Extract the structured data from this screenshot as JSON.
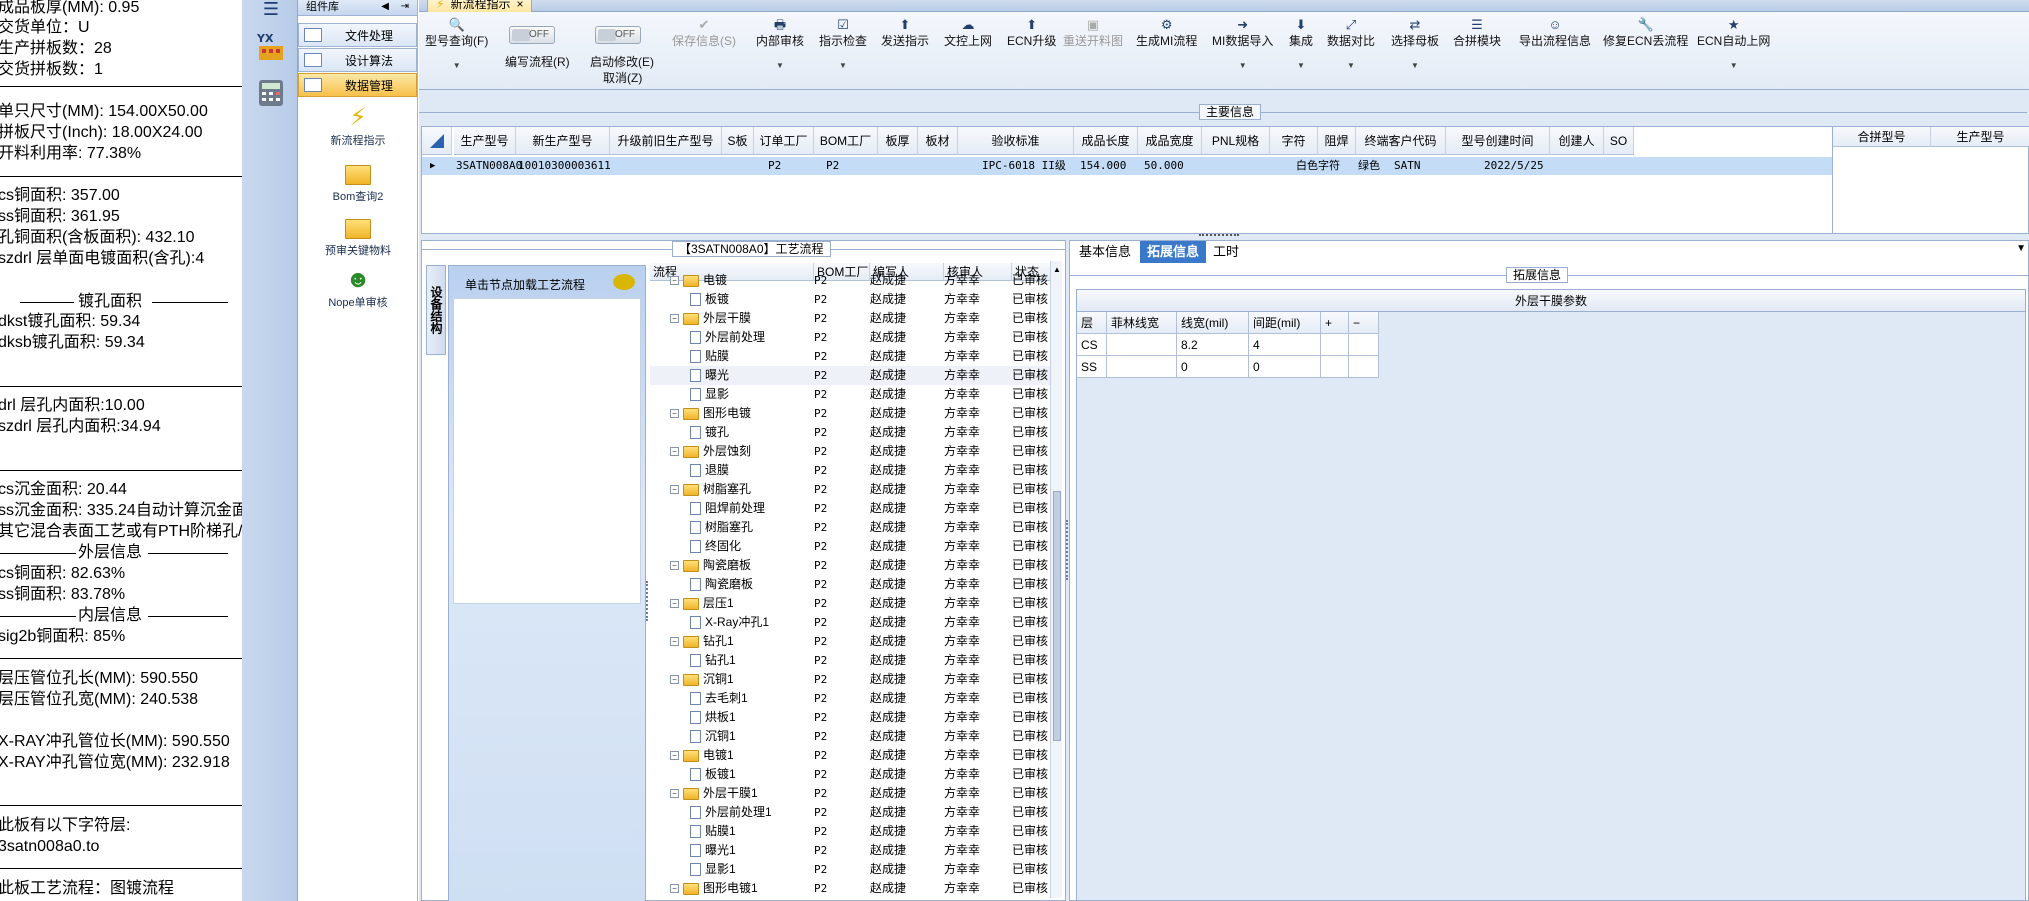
{
  "left_panel": {
    "lines": [
      "成品板厚(MM): 0.95",
      "交货单位：U",
      "生产拼板数：28",
      "交货拼板数：1",
      "单只尺寸(MM): 154.00X50.00",
      "拼板尺寸(Inch): 18.00X24.00",
      "开料利用率: 77.38%",
      "cs铜面积: 357.00",
      "ss铜面积: 361.95",
      "孔铜面积(含板面积): 432.10",
      "szdrl        层单面电镀面积(含孔):4",
      "dkst镀孔面积: 59.34",
      "dksb镀孔面积: 59.34",
      "drl          层孔内面积:10.00",
      "szdrl        层孔内面积:34.94",
      "cs沉金面积: 20.44",
      "ss沉金面积: 335.24自动计算沉金面",
      "其它混合表面工艺或有PTH阶梯孔/",
      "cs铜面积: 82.63%",
      "ss铜面积: 83.78%",
      "sig2b铜面积: 85%",
      "层压管位孔长(MM): 590.550",
      "层压管位孔宽(MM): 240.538",
      "X-RAY冲孔管位长(MM): 590.550",
      "X-RAY冲孔管位宽(MM): 232.918",
      "此板有以下字符层:",
      "3satn008a0.to",
      "此板工艺流程：图镀流程"
    ],
    "section_plating": "镀孔面积",
    "section_outer": "外层信息",
    "section_inner": "内层信息"
  },
  "comp_panel": {
    "title": "组件库",
    "buttons": [
      "文件处理",
      "设计算法",
      "数据管理"
    ],
    "items": [
      "新流程指示",
      "Bom查询2",
      "预审关键物料",
      "Nope单审核"
    ]
  },
  "tab": {
    "title": "新流程指示",
    "close": "×"
  },
  "toolbar": {
    "buttons": [
      {
        "label": "型号查询(F)",
        "icon": "🔍"
      },
      {
        "label": "保存信息(S)",
        "icon": "✔",
        "disabled": true
      },
      {
        "label": "内部审核",
        "icon": "🖶"
      },
      {
        "label": "指示检查",
        "icon": "☑"
      },
      {
        "label": "发送指示",
        "icon": "⬆"
      },
      {
        "label": "文控上网",
        "icon": "☁"
      },
      {
        "label": "ECN升级",
        "icon": "⬆"
      },
      {
        "label": "重送开料图",
        "icon": "▣",
        "disabled": true
      },
      {
        "label": "生成MI流程",
        "icon": "⚙"
      },
      {
        "label": "MI数据导入",
        "icon": "➜"
      },
      {
        "label": "集成",
        "icon": "⬇"
      },
      {
        "label": "数据对比",
        "icon": "⤢"
      },
      {
        "label": "选择母板",
        "icon": "⇄"
      },
      {
        "label": "合拼模块",
        "icon": "☰"
      },
      {
        "label": "导出流程信息",
        "icon": "☺"
      },
      {
        "label": "修复ECN丢流程",
        "icon": "🔧"
      },
      {
        "label": "ECN自动上网",
        "icon": "★"
      }
    ],
    "toggle1_label": "编写流程(R)",
    "toggle2_label": "启动修改(E)",
    "toggle2_sub": "取消(Z)",
    "toggle_text": "OFF"
  },
  "main_info": {
    "title": "主要信息",
    "columns": [
      "生产型号",
      "新生产型号",
      "升级前旧生产型号",
      "S板",
      "订单工厂",
      "BOM工厂",
      "板厚",
      "板材",
      "验收标准",
      "成品长度",
      "成品宽度",
      "PNL规格",
      "字符",
      "阻焊",
      "终端客户代码",
      "型号创建时间",
      "创建人",
      "SO"
    ],
    "row": [
      "3SATN008A0",
      "10010300003611",
      "",
      "",
      "P2",
      "P2",
      "",
      "",
      "IPC-6018 II级",
      "154.000",
      "50.000",
      "",
      "白色字符",
      "绿色",
      "SATN",
      "2022/5/25",
      "",
      ""
    ],
    "merge_columns": [
      "合拼型号",
      "生产型号"
    ]
  },
  "process": {
    "title": "【3SATN008A0】工艺流程",
    "vtab": "设备结构",
    "node_hint": "单击节点加载工艺流程",
    "columns": [
      "流程",
      "BOM工厂",
      "编写人",
      "核审人",
      "状态"
    ],
    "rows": [
      {
        "name": "电镀",
        "level": 0,
        "folder": true,
        "bom": "P2",
        "writer": "赵成捷",
        "reviewer": "方幸幸",
        "status": "已审核"
      },
      {
        "name": "板镀",
        "level": 1,
        "folder": false,
        "bom": "P2",
        "writer": "赵成捷",
        "reviewer": "方幸幸",
        "status": "已审核"
      },
      {
        "name": "外层干膜",
        "level": 0,
        "folder": true,
        "bom": "P2",
        "writer": "赵成捷",
        "reviewer": "方幸幸",
        "status": "已审核"
      },
      {
        "name": "外层前处理",
        "level": 1,
        "folder": false,
        "bom": "P2",
        "writer": "赵成捷",
        "reviewer": "方幸幸",
        "status": "已审核"
      },
      {
        "name": "贴膜",
        "level": 1,
        "folder": false,
        "bom": "P2",
        "writer": "赵成捷",
        "reviewer": "方幸幸",
        "status": "已审核"
      },
      {
        "name": "曝光",
        "level": 1,
        "folder": false,
        "bom": "P2",
        "writer": "赵成捷",
        "reviewer": "方幸幸",
        "status": "已审核",
        "hl": true
      },
      {
        "name": "显影",
        "level": 1,
        "folder": false,
        "bom": "P2",
        "writer": "赵成捷",
        "reviewer": "方幸幸",
        "status": "已审核"
      },
      {
        "name": "图形电镀",
        "level": 0,
        "folder": true,
        "bom": "P2",
        "writer": "赵成捷",
        "reviewer": "方幸幸",
        "status": "已审核"
      },
      {
        "name": "镀孔",
        "level": 1,
        "folder": false,
        "bom": "P2",
        "writer": "赵成捷",
        "reviewer": "方幸幸",
        "status": "已审核"
      },
      {
        "name": "外层蚀刻",
        "level": 0,
        "folder": true,
        "bom": "P2",
        "writer": "赵成捷",
        "reviewer": "方幸幸",
        "status": "已审核"
      },
      {
        "name": "退膜",
        "level": 1,
        "folder": false,
        "bom": "P2",
        "writer": "赵成捷",
        "reviewer": "方幸幸",
        "status": "已审核"
      },
      {
        "name": "树脂塞孔",
        "level": 0,
        "folder": true,
        "bom": "P2",
        "writer": "赵成捷",
        "reviewer": "方幸幸",
        "status": "已审核"
      },
      {
        "name": "阻焊前处理",
        "level": 1,
        "folder": false,
        "bom": "P2",
        "writer": "赵成捷",
        "reviewer": "方幸幸",
        "status": "已审核"
      },
      {
        "name": "树脂塞孔",
        "level": 1,
        "folder": false,
        "bom": "P2",
        "writer": "赵成捷",
        "reviewer": "方幸幸",
        "status": "已审核"
      },
      {
        "name": "终固化",
        "level": 1,
        "folder": false,
        "bom": "P2",
        "writer": "赵成捷",
        "reviewer": "方幸幸",
        "status": "已审核"
      },
      {
        "name": "陶瓷磨板",
        "level": 0,
        "folder": true,
        "bom": "P2",
        "writer": "赵成捷",
        "reviewer": "方幸幸",
        "status": "已审核"
      },
      {
        "name": "陶瓷磨板",
        "level": 1,
        "folder": false,
        "bom": "P2",
        "writer": "赵成捷",
        "reviewer": "方幸幸",
        "status": "已审核"
      },
      {
        "name": "层压1",
        "level": 0,
        "folder": true,
        "bom": "P2",
        "writer": "赵成捷",
        "reviewer": "方幸幸",
        "status": "已审核"
      },
      {
        "name": "X-Ray冲孔1",
        "level": 1,
        "folder": false,
        "bom": "P2",
        "writer": "赵成捷",
        "reviewer": "方幸幸",
        "status": "已审核"
      },
      {
        "name": "钻孔1",
        "level": 0,
        "folder": true,
        "bom": "P2",
        "writer": "赵成捷",
        "reviewer": "方幸幸",
        "status": "已审核"
      },
      {
        "name": "钻孔1",
        "level": 1,
        "folder": false,
        "bom": "P2",
        "writer": "赵成捷",
        "reviewer": "方幸幸",
        "status": "已审核"
      },
      {
        "name": "沉铜1",
        "level": 0,
        "folder": true,
        "bom": "P2",
        "writer": "赵成捷",
        "reviewer": "方幸幸",
        "status": "已审核"
      },
      {
        "name": "去毛刺1",
        "level": 1,
        "folder": false,
        "bom": "P2",
        "writer": "赵成捷",
        "reviewer": "方幸幸",
        "status": "已审核"
      },
      {
        "name": "烘板1",
        "level": 1,
        "folder": false,
        "bom": "P2",
        "writer": "赵成捷",
        "reviewer": "方幸幸",
        "status": "已审核"
      },
      {
        "name": "沉铜1",
        "level": 1,
        "folder": false,
        "bom": "P2",
        "writer": "赵成捷",
        "reviewer": "方幸幸",
        "status": "已审核"
      },
      {
        "name": "电镀1",
        "level": 0,
        "folder": true,
        "bom": "P2",
        "writer": "赵成捷",
        "reviewer": "方幸幸",
        "status": "已审核"
      },
      {
        "name": "板镀1",
        "level": 1,
        "folder": false,
        "bom": "P2",
        "writer": "赵成捷",
        "reviewer": "方幸幸",
        "status": "已审核"
      },
      {
        "name": "外层干膜1",
        "level": 0,
        "folder": true,
        "bom": "P2",
        "writer": "赵成捷",
        "reviewer": "方幸幸",
        "status": "已审核"
      },
      {
        "name": "外层前处理1",
        "level": 1,
        "folder": false,
        "bom": "P2",
        "writer": "赵成捷",
        "reviewer": "方幸幸",
        "status": "已审核"
      },
      {
        "name": "贴膜1",
        "level": 1,
        "folder": false,
        "bom": "P2",
        "writer": "赵成捷",
        "reviewer": "方幸幸",
        "status": "已审核"
      },
      {
        "name": "曝光1",
        "level": 1,
        "folder": false,
        "bom": "P2",
        "writer": "赵成捷",
        "reviewer": "方幸幸",
        "status": "已审核"
      },
      {
        "name": "显影1",
        "level": 1,
        "folder": false,
        "bom": "P2",
        "writer": "赵成捷",
        "reviewer": "方幸幸",
        "status": "已审核"
      },
      {
        "name": "图形电镀1",
        "level": 0,
        "folder": true,
        "bom": "P2",
        "writer": "赵成捷",
        "reviewer": "方幸幸",
        "status": "已审核"
      }
    ]
  },
  "right": {
    "tabs": [
      "基本信息",
      "拓展信息",
      "工时"
    ],
    "active_tab": 1,
    "ext_title": "拓展信息",
    "grid_title": "外层干膜参数",
    "grid_columns": [
      "层",
      "菲林线宽",
      "线宽(mil)",
      "间距(mil)",
      "+",
      "−"
    ],
    "grid_rows": [
      [
        "CS",
        "",
        "8.2",
        "4",
        "",
        ""
      ],
      [
        "SS",
        "",
        "0",
        "0",
        "",
        ""
      ]
    ]
  }
}
